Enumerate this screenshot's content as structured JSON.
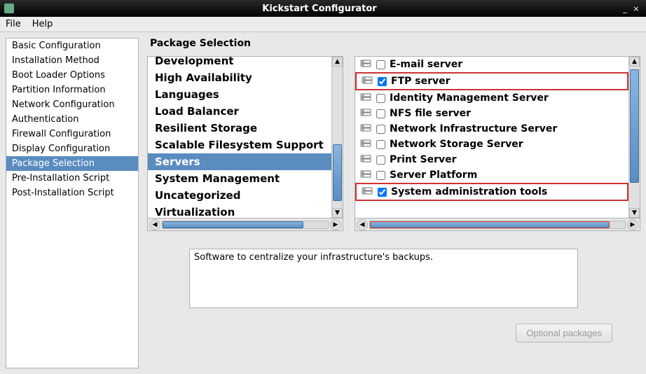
{
  "window": {
    "title": "Kickstart Configurator",
    "min": "_",
    "close": "×"
  },
  "menubar": {
    "file": "File",
    "help": "Help"
  },
  "sidebar": {
    "items": [
      "Basic Configuration",
      "Installation Method",
      "Boot Loader Options",
      "Partition Information",
      "Network Configuration",
      "Authentication",
      "Firewall Configuration",
      "Display Configuration",
      "Package Selection",
      "Pre-Installation Script",
      "Post-Installation Script"
    ],
    "selected_index": 8
  },
  "main": {
    "title": "Package Selection",
    "categories": [
      "Development",
      "High Availability",
      "Languages",
      "Load Balancer",
      "Resilient Storage",
      "Scalable Filesystem Support",
      "Servers",
      "System Management",
      "Uncategorized",
      "Virtualization"
    ],
    "category_selected_index": 6,
    "packages": [
      {
        "label": "E-mail server",
        "checked": false,
        "highlight": false
      },
      {
        "label": "FTP server",
        "checked": true,
        "highlight": true
      },
      {
        "label": "Identity Management Server",
        "checked": false,
        "highlight": false
      },
      {
        "label": "NFS file server",
        "checked": false,
        "highlight": false
      },
      {
        "label": "Network Infrastructure Server",
        "checked": false,
        "highlight": false
      },
      {
        "label": "Network Storage Server",
        "checked": false,
        "highlight": false
      },
      {
        "label": "Print Server",
        "checked": false,
        "highlight": false
      },
      {
        "label": "Server Platform",
        "checked": false,
        "highlight": false
      },
      {
        "label": "System administration tools",
        "checked": true,
        "highlight": true
      }
    ],
    "description": "Software to centralize your infrastructure's backups.",
    "optional_button": "Optional packages"
  }
}
